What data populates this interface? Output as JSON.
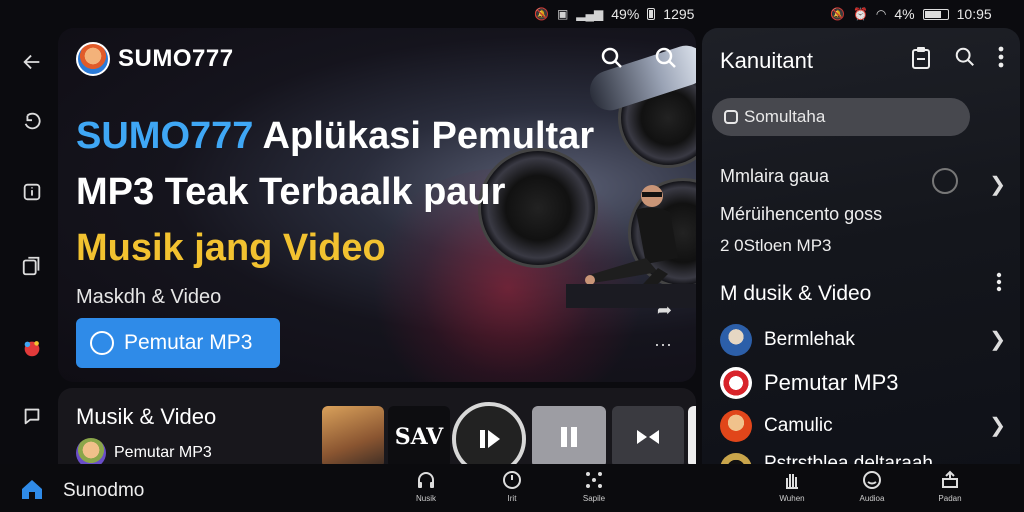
{
  "status_left": {
    "icons": [
      "mute-icon",
      "nfc-icon",
      "signal-icon",
      "battery-icon"
    ],
    "battery": "49%",
    "time": "1295"
  },
  "status_right": {
    "icons": [
      "mute-icon",
      "alarm-icon",
      "wifi-icon",
      "battery-icon"
    ],
    "battery": "4%",
    "time": "10:95"
  },
  "rail": {
    "icons": [
      "back-arrow-icon",
      "undo-icon",
      "info-icon",
      "copy-icon",
      "app-icon",
      "chat-icon"
    ]
  },
  "hero": {
    "brand": "SUMO777",
    "title_part1": "SUMO777",
    "title_part2": " Aplükasi Pemultar MP3 Teak Terbaalk paur",
    "title_part3": "Musik jang Video",
    "subtitle": "Maskdh & Video",
    "cta_label": "Pemutar MP3",
    "thumb_text": "SAV"
  },
  "strip": {
    "title": "Musik & Video",
    "subtitle": "Pemutar MP3"
  },
  "panel": {
    "title": "Kanuitant",
    "search_placeholder": "Somultaha",
    "info_line1": "Mmlaira gaua",
    "info_line2": "Mérüihencento goss",
    "info_line3": "2 0Stloen MP3",
    "section_title": "M dusik & Video",
    "items": [
      {
        "label": "Bermlehak"
      },
      {
        "label": "Pemutar MP3"
      },
      {
        "label": "Camulic"
      },
      {
        "label": "Pstrstblea deltaraah"
      }
    ]
  },
  "bottom": {
    "home_label": "Sunodmo",
    "nav_left": [
      {
        "label": "Nusik",
        "icon": "headphones-icon"
      },
      {
        "label": "Irit",
        "icon": "timer-icon"
      },
      {
        "label": "Sapile",
        "icon": "grid-icon"
      }
    ],
    "nav_right": [
      {
        "label": "Wuhen",
        "icon": "hand-icon"
      },
      {
        "label": "Audioa",
        "icon": "smile-icon"
      },
      {
        "label": "Padan",
        "icon": "tray-icon"
      }
    ]
  },
  "colors": {
    "accent": "#2f8be8",
    "title_blue": "#3fa7f5",
    "title_yellow": "#f2c230"
  }
}
